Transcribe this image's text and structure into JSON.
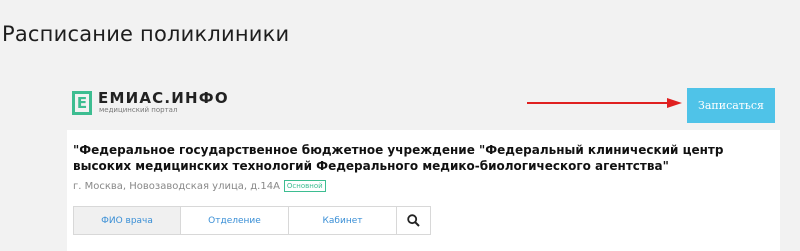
{
  "page": {
    "title": "Расписание поликлиники"
  },
  "logo": {
    "mark": "E",
    "name": "ЕМИАС.ИНФО",
    "subtitle": "медицинский портал"
  },
  "actions": {
    "signup_label": "Записаться",
    "arrow_color": "#e02020"
  },
  "clinic": {
    "name": "\"Федеральное государственное бюджетное учреждение \"Федеральный клинический центр высоких медицинских технологий Федерального медико-биологического агентства\"",
    "address": "г. Москва, Новозаводская улица, д.14А",
    "badge": "Основной"
  },
  "tabs": [
    {
      "label": "ФИО врача",
      "active": true
    },
    {
      "label": "Отделение",
      "active": false
    },
    {
      "label": "Кабинет",
      "active": false
    }
  ],
  "search": {
    "icon": "search-icon"
  },
  "colors": {
    "accent": "#4fc3e8",
    "brand": "#3dbd91",
    "link": "#3a8fd6"
  }
}
